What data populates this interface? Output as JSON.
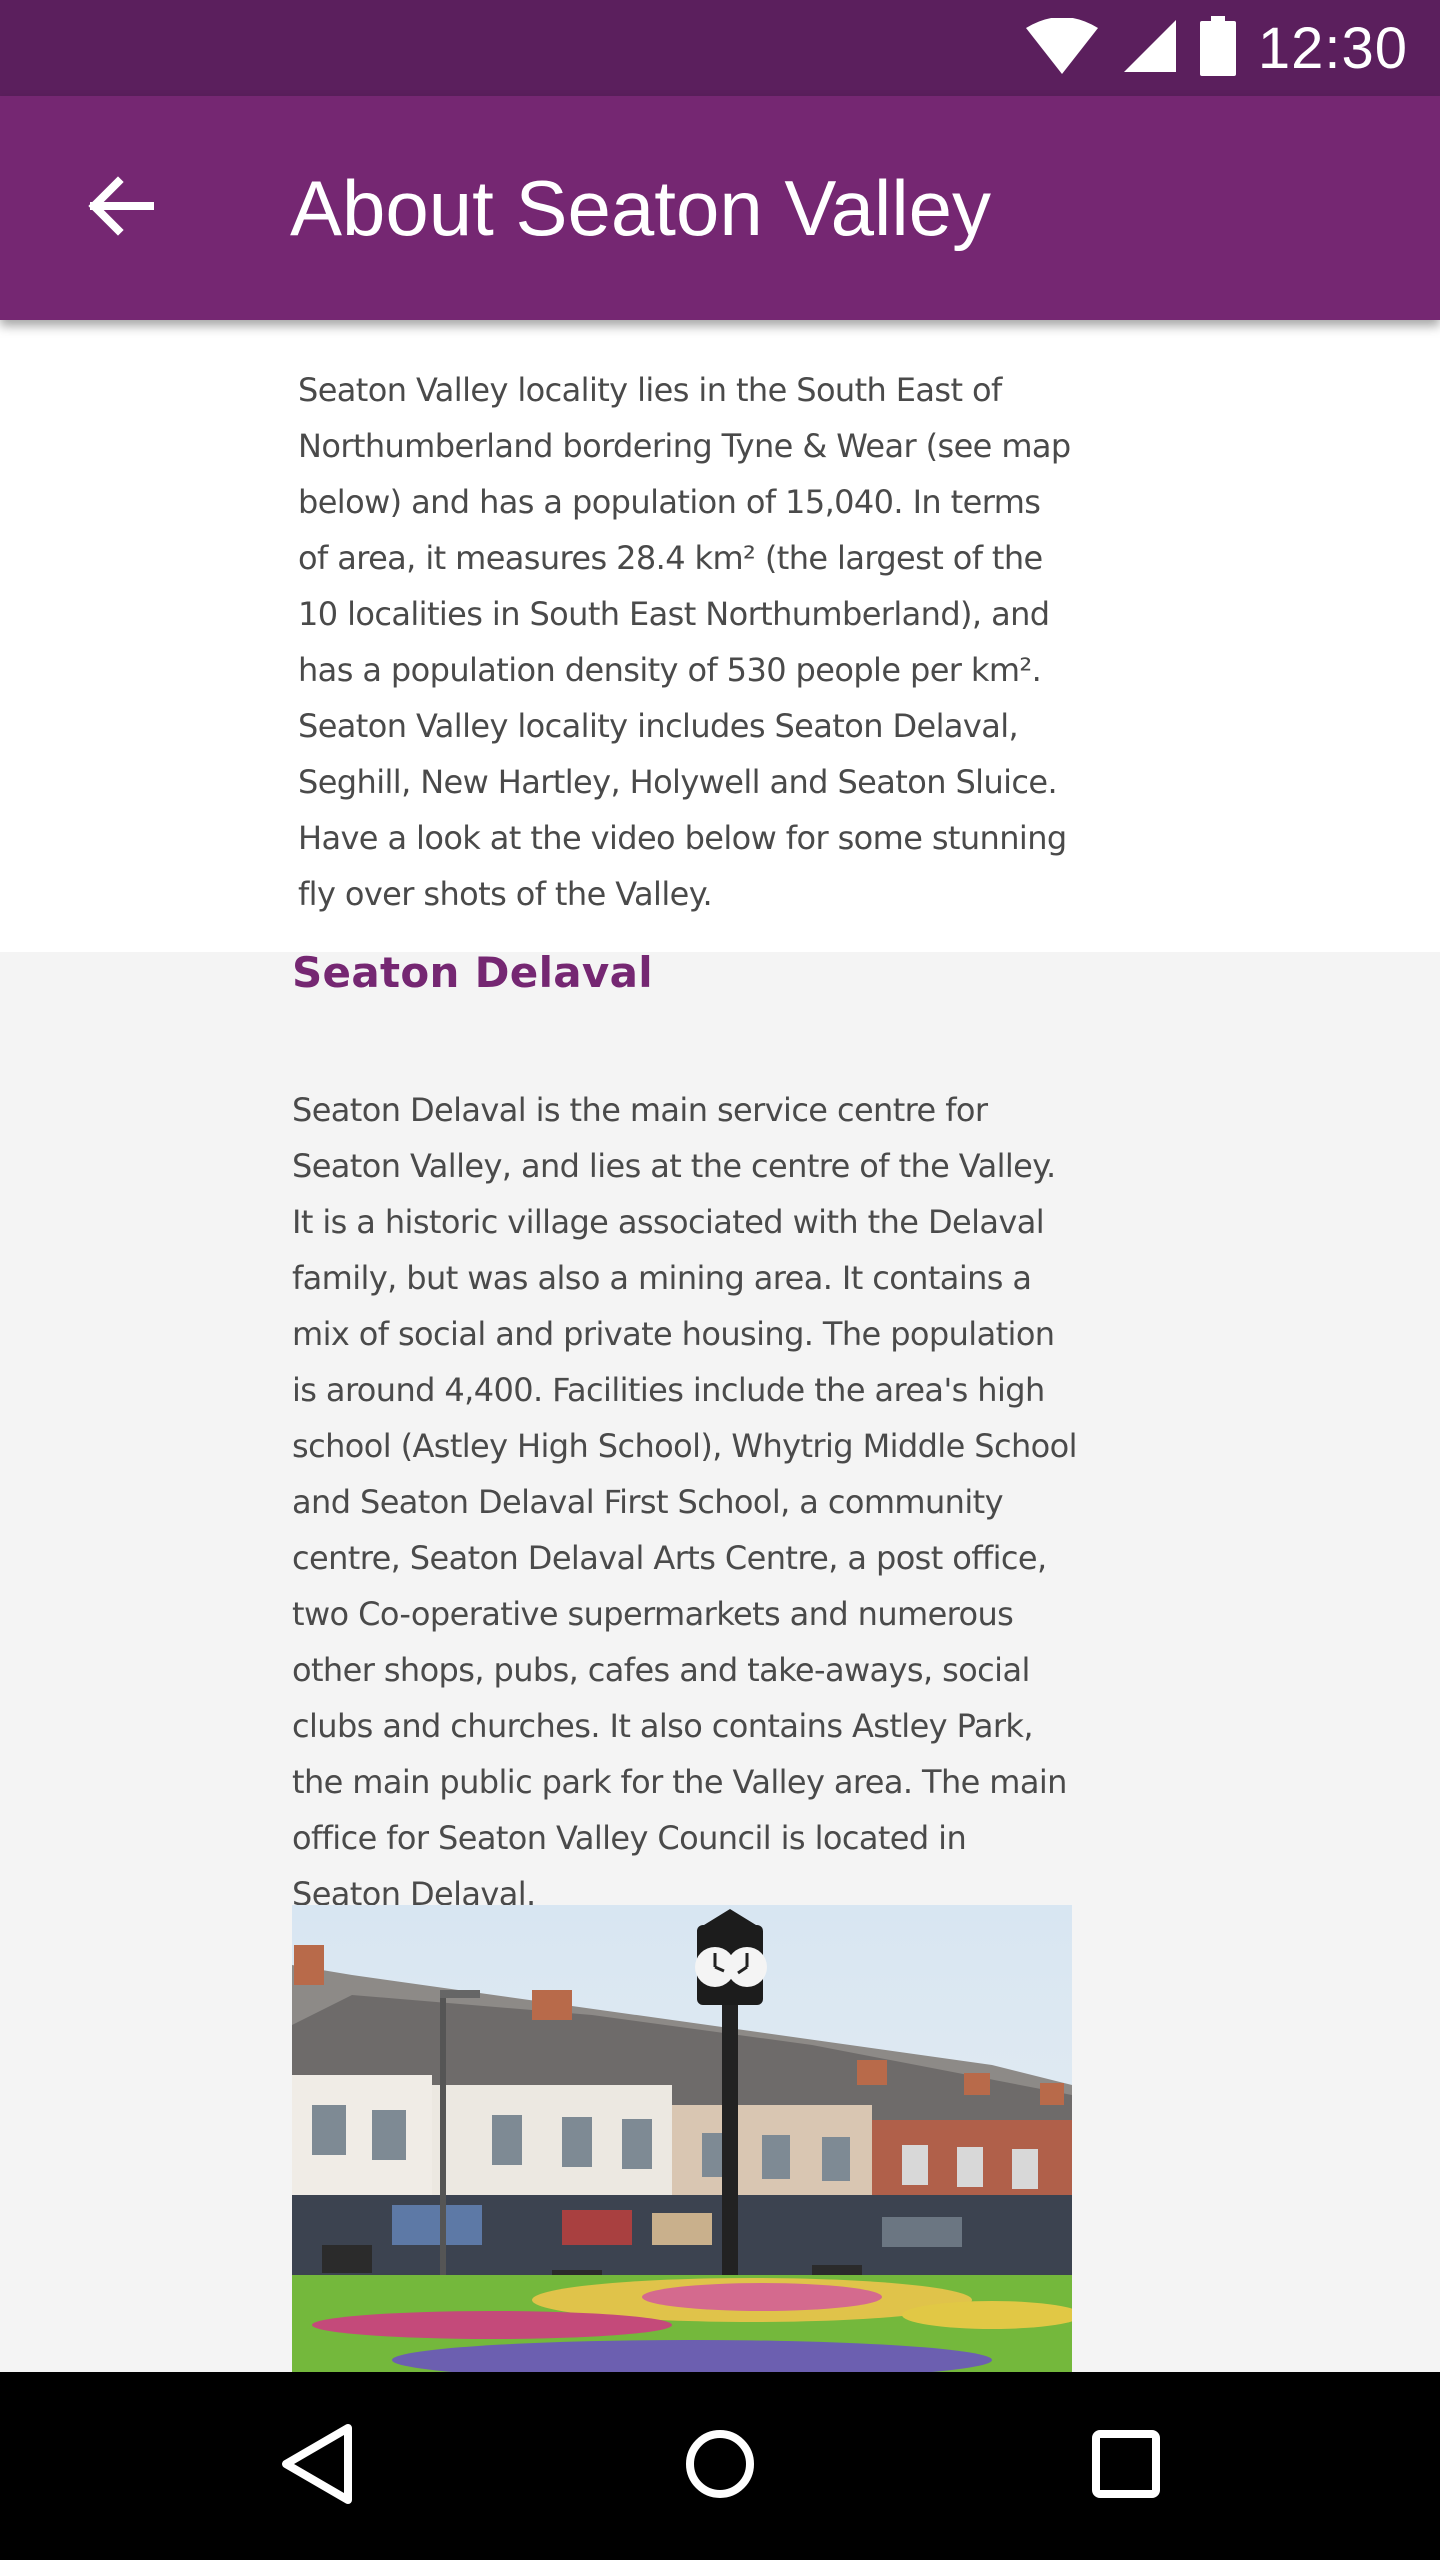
{
  "status_bar": {
    "time": "12:30",
    "icons": [
      "wifi-icon",
      "cell-signal-icon",
      "battery-icon"
    ]
  },
  "app_bar": {
    "title": "About Seaton Valley",
    "back_icon": "arrow-back-icon"
  },
  "intro": {
    "text": "Seaton Valley locality lies in the South East of Northumberland bordering Tyne & Wear (see map below) and has a population of 15,040. In terms of area, it measures 28.4 km² (the largest of the 10 localities in South East Northumberland), and has a population density of 530 people per km². Seaton Valley locality includes Seaton Delaval, Seghill, New Hartley, Holywell and Seaton Sluice. Have a look at the video below for some stunning fly over shots of the Valley."
  },
  "section": {
    "heading": "Seaton Delaval",
    "text": "Seaton Delaval is the main service centre for Seaton Valley, and lies at the centre of the Valley. It is a historic village associated with the Delaval family, but was also a mining area. It contains a mix of social and private housing. The population is around 4,400. Facilities include the area's high school (Astley High School), Whytrig Middle School and Seaton Delaval First School, a community centre, Seaton Delaval Arts Centre, a post office, two Co-operative supermarkets and numerous other shops, pubs, cafes and take-aways, social clubs and churches. It also contains Astley Park, the main public park for the Valley area. The main office for Seaton Valley Council is located in Seaton Delaval."
  },
  "nav_bar": {
    "icons": [
      "back-triangle-icon",
      "home-circle-icon",
      "recents-square-icon"
    ]
  },
  "colors": {
    "status_bar": "#5b1f5d",
    "app_bar": "#752772",
    "heading": "#752772",
    "body_text": "#4a4a4a",
    "section_bg": "#f4f4f4"
  }
}
